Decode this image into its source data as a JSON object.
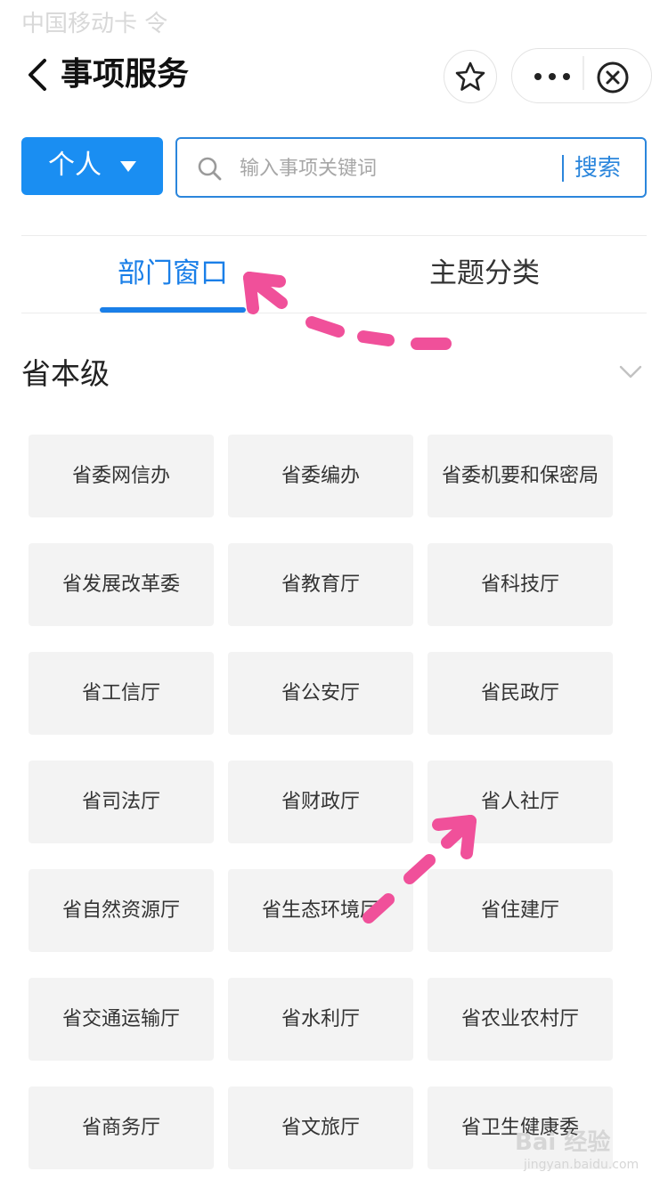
{
  "status_bar": {
    "carrier_text": "中国移动卡 令"
  },
  "nav": {
    "title": "事项服务",
    "icons": {
      "back": "chevron-left-icon",
      "star": "star-icon",
      "more": "more-dots-icon",
      "close": "close-circle-icon"
    }
  },
  "search": {
    "type_label": "个人",
    "placeholder": "输入事项关键词",
    "button_label": "搜索",
    "accent_color": "#1a8ef2"
  },
  "tabs": [
    {
      "label": "部门窗口",
      "active": true
    },
    {
      "label": "主题分类",
      "active": false
    }
  ],
  "section": {
    "title": "省本级"
  },
  "departments": [
    "省委网信办",
    "省委编办",
    "省委机要和保密局",
    "省发展改革委",
    "省教育厅",
    "省科技厅",
    "省工信厅",
    "省公安厅",
    "省民政厅",
    "省司法厅",
    "省财政厅",
    "省人社厅",
    "省自然资源厅",
    "省生态环境厅",
    "省住建厅",
    "省交通运输厅",
    "省水利厅",
    "省农业农村厅",
    "省商务厅",
    "省文旅厅",
    "省卫生健康委"
  ],
  "watermark": {
    "text": "Bai 经验",
    "sub": "jingyan.baidu.com"
  },
  "colors": {
    "active_tab": "#1a7fe8",
    "annotation_arrow": "#f0509a",
    "cell_bg": "#f3f3f3"
  }
}
